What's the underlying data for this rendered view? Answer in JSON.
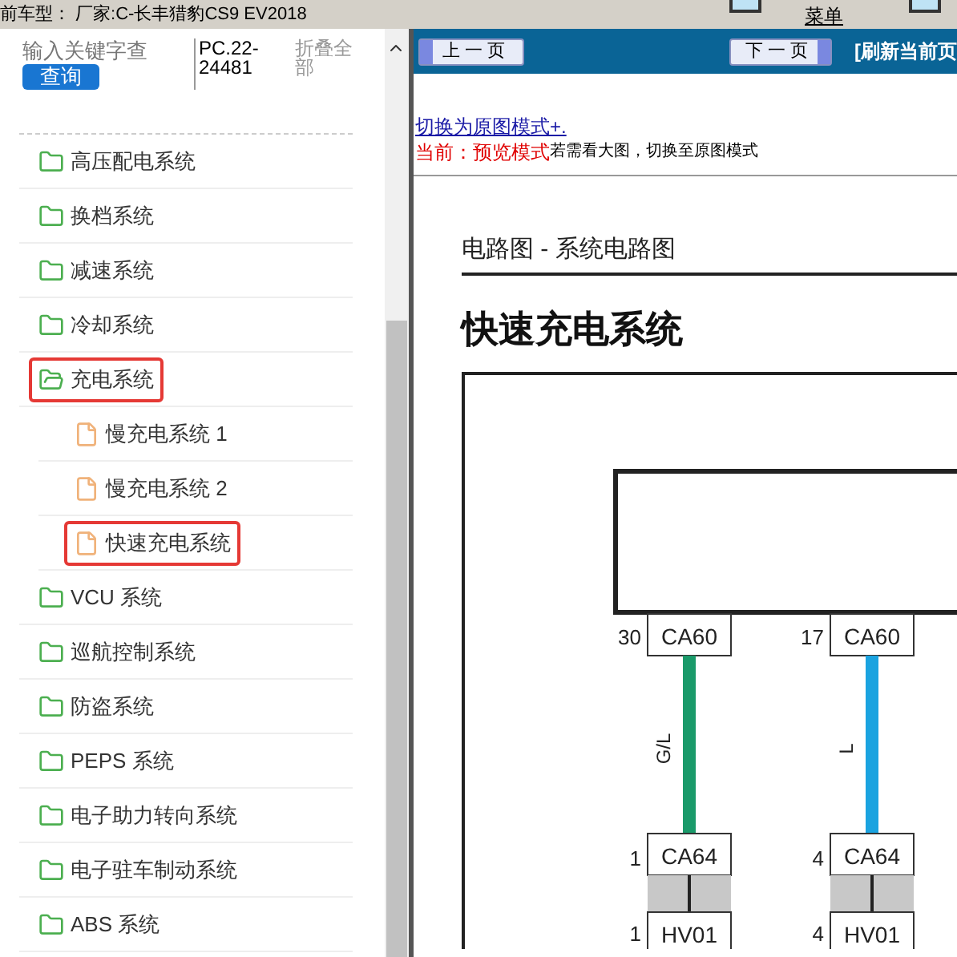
{
  "top_bar": {
    "vehicle": "前车型： 厂家:C-长丰猎豹CS9 EV2018",
    "menu_label": "菜单"
  },
  "sidebar": {
    "search_placeholder": "输入关键字查",
    "search_button": "查询",
    "code": "PC.22-24481",
    "collapse_all": "折叠全部",
    "items": [
      {
        "label": "高压配电系统",
        "expanded": false,
        "highlighted": false
      },
      {
        "label": "换档系统",
        "expanded": false,
        "highlighted": false
      },
      {
        "label": "减速系统",
        "expanded": false,
        "highlighted": false
      },
      {
        "label": "冷却系统",
        "expanded": false,
        "highlighted": false
      },
      {
        "label": "充电系统",
        "expanded": true,
        "highlighted": true,
        "children": [
          {
            "label": "慢充电系统 1",
            "highlighted": false
          },
          {
            "label": "慢充电系统 2",
            "highlighted": false
          },
          {
            "label": "快速充电系统",
            "highlighted": true
          }
        ]
      },
      {
        "label": "VCU 系统",
        "expanded": false,
        "highlighted": false
      },
      {
        "label": "巡航控制系统",
        "expanded": false,
        "highlighted": false
      },
      {
        "label": "防盗系统",
        "expanded": false,
        "highlighted": false
      },
      {
        "label": "PEPS 系统",
        "expanded": false,
        "highlighted": false
      },
      {
        "label": "电子助力转向系统",
        "expanded": false,
        "highlighted": false
      },
      {
        "label": "电子驻车制动系统",
        "expanded": false,
        "highlighted": false
      },
      {
        "label": "ABS 系统",
        "expanded": false,
        "highlighted": false
      }
    ]
  },
  "nav": {
    "prev": "上 一 页",
    "next": "下 一 页",
    "refresh": "[刷新当前页"
  },
  "mode": {
    "switch_link": "切换为原图模式+.",
    "current": "当前：预览模式",
    "hint": "若需看大图，切换至原图模式"
  },
  "document": {
    "breadcrumb": "电路图 - 系统电路图",
    "title": "快速充电系统",
    "wires": [
      {
        "pin": "30",
        "connector": "CA60",
        "wire_code": "G/L",
        "color": "#1a9a6a",
        "lower_pin": "1",
        "lower_connector": "CA64",
        "end_pin": "1",
        "end_connector": "HV01"
      },
      {
        "pin": "17",
        "connector": "CA60",
        "wire_code": "L",
        "color": "#1aa3e0",
        "lower_pin": "4",
        "lower_connector": "CA64",
        "end_pin": "4",
        "end_connector": "HV01"
      }
    ]
  }
}
